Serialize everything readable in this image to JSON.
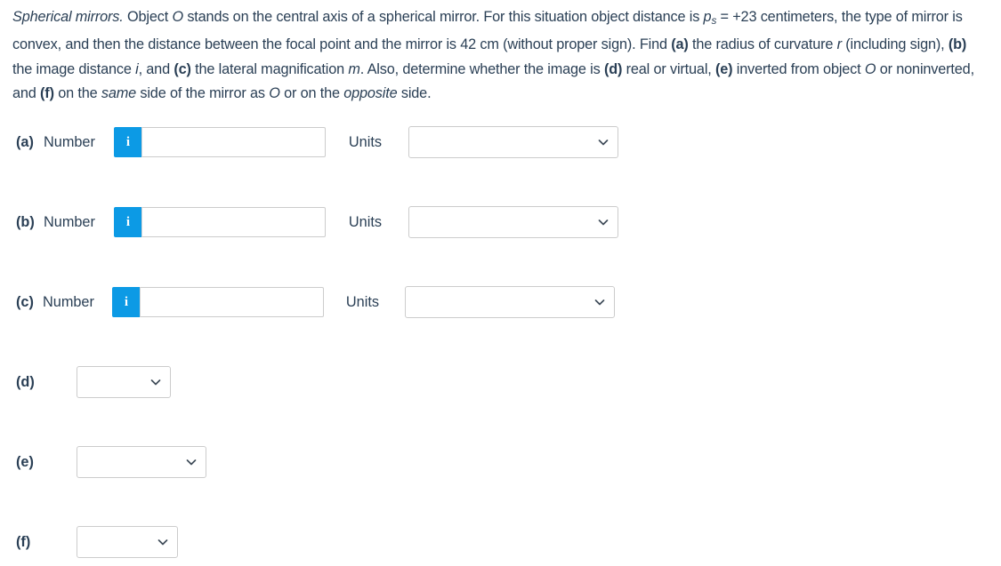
{
  "problem": {
    "title": "Spherical mirrors.",
    "sentence_1_a": " Object ",
    "var_O_1": "O",
    "sentence_1_b": " stands on the central axis of a spherical mirror. For this situation object distance is ",
    "var_p": "p",
    "var_p_sub": "s",
    "sentence_1_c": " = +23 centimeters, the type of mirror is convex, and then the distance between the focal point and the mirror is 42 cm (without proper sign). Find ",
    "label_a": "(a)",
    "sentence_2_a": " the radius of curvature ",
    "var_r": "r",
    "sentence_2_b": " (including sign), ",
    "label_b": "(b)",
    "sentence_2_c": " the image distance ",
    "var_i": "i",
    "sentence_2_d": ", and ",
    "label_c": "(c)",
    "sentence_2_e": " the lateral magnification ",
    "var_m": "m",
    "sentence_2_f": ". Also, determine whether the image is ",
    "label_d": "(d)",
    "sentence_3_a": " real or virtual, ",
    "label_e": "(e)",
    "sentence_3_b": " inverted from object ",
    "var_O_2": "O",
    "sentence_3_c": " or noninverted, and ",
    "label_f": "(f)",
    "sentence_3_d": " on the ",
    "em_same": "same",
    "sentence_3_e": " side of the mirror as ",
    "var_O_3": "O",
    "sentence_3_f": " or on the ",
    "em_opposite": "opposite",
    "sentence_3_g": " side."
  },
  "answer_rows": [
    {
      "part": "(a)",
      "number_caption": "Number",
      "info_icon": "i",
      "number_value": "",
      "number_placeholder": "",
      "units_caption": "Units",
      "units_value": "",
      "dropdown_icon": "chevron-down-icon"
    },
    {
      "part": "(b)",
      "number_caption": "Number",
      "info_icon": "i",
      "number_value": "",
      "number_placeholder": "",
      "units_caption": "Units",
      "units_value": "",
      "dropdown_icon": "chevron-down-icon"
    },
    {
      "part": "(c)",
      "number_caption": "Number",
      "info_icon": "i",
      "number_value": "",
      "number_placeholder": "",
      "units_caption": "Units",
      "units_value": "",
      "dropdown_icon": "chevron-down-icon"
    }
  ],
  "choice_rows": [
    {
      "part": "(d)",
      "value": "",
      "dropdown_icon": "chevron-down-icon"
    },
    {
      "part": "(e)",
      "value": "",
      "dropdown_icon": "chevron-down-icon"
    },
    {
      "part": "(f)",
      "value": "",
      "dropdown_icon": "chevron-down-icon"
    }
  ],
  "colors": {
    "text": "#2a3f55",
    "info_badge": "#0c9ae5",
    "border": "#cccccc",
    "background": "#ffffff"
  }
}
